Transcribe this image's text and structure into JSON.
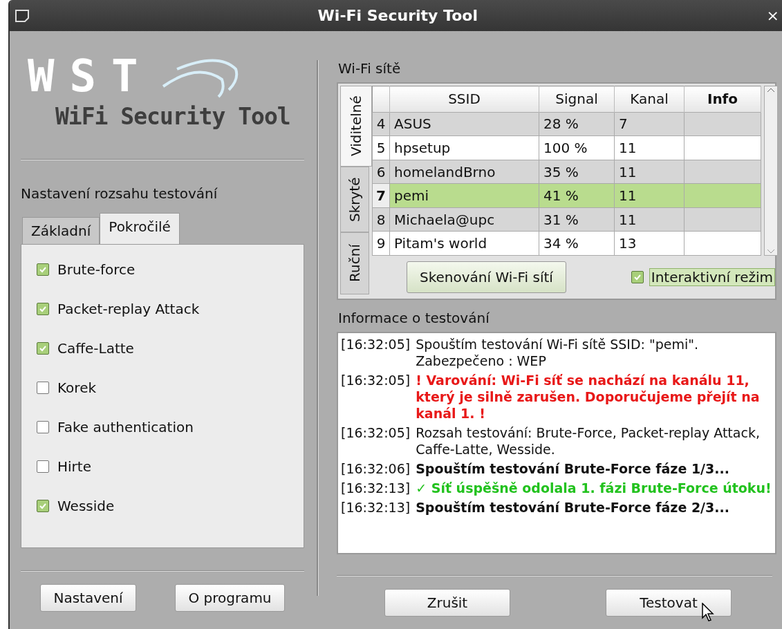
{
  "window": {
    "title": "Wi-Fi Security Tool",
    "close": "×"
  },
  "logo": {
    "mark": "WST",
    "name": "WiFi Security Tool"
  },
  "scope": {
    "heading": "Nastavení rozsahu testování",
    "tabs": [
      {
        "label": "Základní",
        "selected": false
      },
      {
        "label": "Pokročilé",
        "selected": true
      }
    ],
    "options": [
      {
        "label": "Brute-force",
        "checked": true
      },
      {
        "label": "Packet-replay Attack",
        "checked": true
      },
      {
        "label": "Caffe-Latte",
        "checked": true
      },
      {
        "label": "Korek",
        "checked": false
      },
      {
        "label": "Fake authentication",
        "checked": false
      },
      {
        "label": "Hirte",
        "checked": false
      },
      {
        "label": "Wesside",
        "checked": true
      }
    ]
  },
  "left_buttons": [
    "Nastavení",
    "O programu"
  ],
  "networks": {
    "heading": "Wi-Fi sítě",
    "tabs": [
      {
        "label": "Viditelné",
        "selected": true
      },
      {
        "label": "Skryté",
        "selected": false
      },
      {
        "label": "Ruční",
        "selected": false
      }
    ],
    "columns": [
      {
        "label": "SSID",
        "selected": false
      },
      {
        "label": "Signal",
        "selected": false
      },
      {
        "label": "Kanal",
        "selected": false
      },
      {
        "label": "Info",
        "selected": true
      }
    ],
    "rows": [
      {
        "num": "4",
        "ssid": "ASUS",
        "signal": "28 %",
        "channel": "7",
        "selected": false
      },
      {
        "num": "5",
        "ssid": "hpsetup",
        "signal": "100 %",
        "channel": "11",
        "selected": false
      },
      {
        "num": "6",
        "ssid": "homelandBrno",
        "signal": "35 %",
        "channel": "11",
        "selected": false
      },
      {
        "num": "7",
        "ssid": "pemi",
        "signal": "41 %",
        "channel": "11",
        "selected": true
      },
      {
        "num": "8",
        "ssid": "Michaela@upc",
        "signal": "31 %",
        "channel": "11",
        "selected": false
      },
      {
        "num": "9",
        "ssid": "Pitam's world",
        "signal": "34 %",
        "channel": "13",
        "selected": false
      }
    ],
    "scan_button": "Skenování Wi-Fi sítí",
    "interactive": {
      "label": "Interaktivní režim",
      "checked": true
    }
  },
  "log": {
    "heading": "Informace o testování",
    "entries": [
      {
        "time": "[16:32:05]",
        "kind": "info",
        "text": "Spouštím testování Wi-Fi sítě SSID: \"pemi\". Zabezpečeno : WEP"
      },
      {
        "time": "[16:32:05]",
        "kind": "warning",
        "text": "! Varování: Wi-Fi síť se nachází na kanálu 11, který je silně zarušen. Doporučujeme přejít na kanál 1. !"
      },
      {
        "time": "[16:32:05]",
        "kind": "info",
        "text": "Rozsah testování: Brute-Force, Packet-replay Attack, Caffe-Latte, Wesside."
      },
      {
        "time": "[16:32:06]",
        "kind": "progress",
        "text": "Spouštím testování Brute-Force fáze 1/3..."
      },
      {
        "time": "[16:32:13]",
        "kind": "success",
        "text": "✓ Síť úspěšně odolala 1. fázi Brute-Force útoku!"
      },
      {
        "time": "[16:32:13]",
        "kind": "progress",
        "text": "Spouštím testování Brute-Force fáze 2/3..."
      }
    ]
  },
  "right_buttons": [
    "Zrušit",
    "Testovat"
  ]
}
